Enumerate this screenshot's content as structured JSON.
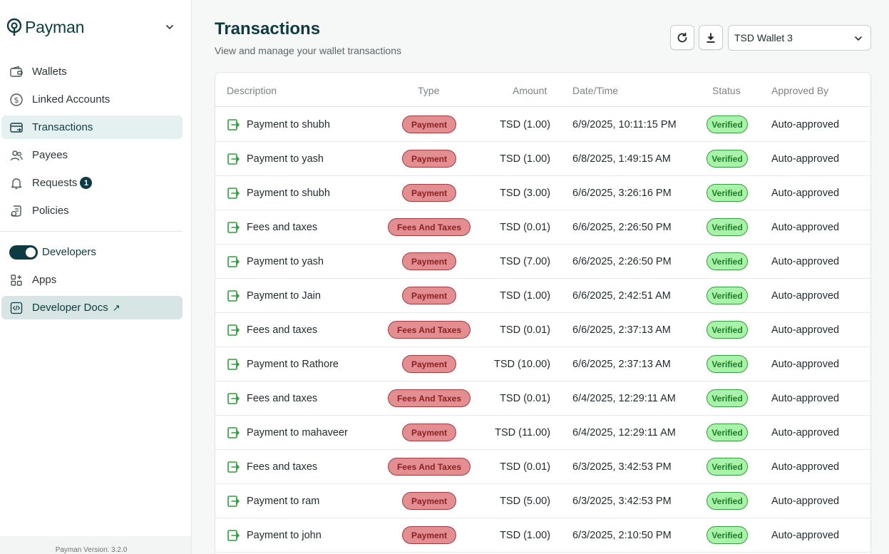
{
  "app": {
    "brand": "Payman",
    "version": "Payman Version: 3.2.0"
  },
  "colors": {
    "brand": "#0e3b43",
    "active_nav_bg": "#e5f1f0",
    "type_pill_bg": "#e38f91",
    "status_pill_bg": "#a9f2a9",
    "row_icon": "#2f9e3a"
  },
  "sidebar": {
    "items": [
      {
        "label": "Wallets",
        "icon": "wallet-icon"
      },
      {
        "label": "Linked Accounts",
        "icon": "dollar-circle-icon"
      },
      {
        "label": "Transactions",
        "icon": "card-transfer-icon"
      },
      {
        "label": "Payees",
        "icon": "users-icon"
      },
      {
        "label": "Requests",
        "icon": "bell-icon",
        "badge": "1"
      },
      {
        "label": "Policies",
        "icon": "policy-icon"
      }
    ],
    "developers_label": "Developers",
    "developers_enabled": true,
    "dev_items": [
      {
        "label": "Apps",
        "icon": "apps-icon"
      },
      {
        "label": "Developer Docs",
        "icon": "code-icon",
        "external": "↗"
      }
    ]
  },
  "page": {
    "title": "Transactions",
    "subtitle": "View and manage your wallet transactions",
    "wallet_select": "TSD Wallet 3"
  },
  "table": {
    "columns": [
      "Description",
      "Type",
      "Amount",
      "Date/Time",
      "Status",
      "Approved By"
    ],
    "rows": [
      {
        "description": "Payment to shubh",
        "type": "Payment",
        "amount": "TSD (1.00)",
        "datetime": "6/9/2025, 10:11:15 PM",
        "status": "Verified",
        "approved_by": "Auto-approved"
      },
      {
        "description": "Payment to yash",
        "type": "Payment",
        "amount": "TSD (1.00)",
        "datetime": "6/8/2025, 1:49:15 AM",
        "status": "Verified",
        "approved_by": "Auto-approved"
      },
      {
        "description": "Payment to shubh",
        "type": "Payment",
        "amount": "TSD (3.00)",
        "datetime": "6/6/2025, 3:26:16 PM",
        "status": "Verified",
        "approved_by": "Auto-approved"
      },
      {
        "description": "Fees and taxes",
        "type": "Fees And Taxes",
        "amount": "TSD (0.01)",
        "datetime": "6/6/2025, 2:26:50 PM",
        "status": "Verified",
        "approved_by": "Auto-approved"
      },
      {
        "description": "Payment to yash",
        "type": "Payment",
        "amount": "TSD (7.00)",
        "datetime": "6/6/2025, 2:26:50 PM",
        "status": "Verified",
        "approved_by": "Auto-approved"
      },
      {
        "description": "Payment to Jain",
        "type": "Payment",
        "amount": "TSD (1.00)",
        "datetime": "6/6/2025, 2:42:51 AM",
        "status": "Verified",
        "approved_by": "Auto-approved"
      },
      {
        "description": "Fees and taxes",
        "type": "Fees And Taxes",
        "amount": "TSD (0.01)",
        "datetime": "6/6/2025, 2:37:13 AM",
        "status": "Verified",
        "approved_by": "Auto-approved"
      },
      {
        "description": "Payment to Rathore",
        "type": "Payment",
        "amount": "TSD (10.00)",
        "datetime": "6/6/2025, 2:37:13 AM",
        "status": "Verified",
        "approved_by": "Auto-approved"
      },
      {
        "description": "Fees and taxes",
        "type": "Fees And Taxes",
        "amount": "TSD (0.01)",
        "datetime": "6/4/2025, 12:29:11 AM",
        "status": "Verified",
        "approved_by": "Auto-approved"
      },
      {
        "description": "Payment to mahaveer",
        "type": "Payment",
        "amount": "TSD (11.00)",
        "datetime": "6/4/2025, 12:29:11 AM",
        "status": "Verified",
        "approved_by": "Auto-approved"
      },
      {
        "description": "Fees and taxes",
        "type": "Fees And Taxes",
        "amount": "TSD (0.01)",
        "datetime": "6/3/2025, 3:42:53 PM",
        "status": "Verified",
        "approved_by": "Auto-approved"
      },
      {
        "description": "Payment to ram",
        "type": "Payment",
        "amount": "TSD (5.00)",
        "datetime": "6/3/2025, 3:42:53 PM",
        "status": "Verified",
        "approved_by": "Auto-approved"
      },
      {
        "description": "Payment to john",
        "type": "Payment",
        "amount": "TSD (1.00)",
        "datetime": "6/3/2025, 2:10:50 PM",
        "status": "Verified",
        "approved_by": "Auto-approved"
      }
    ]
  }
}
